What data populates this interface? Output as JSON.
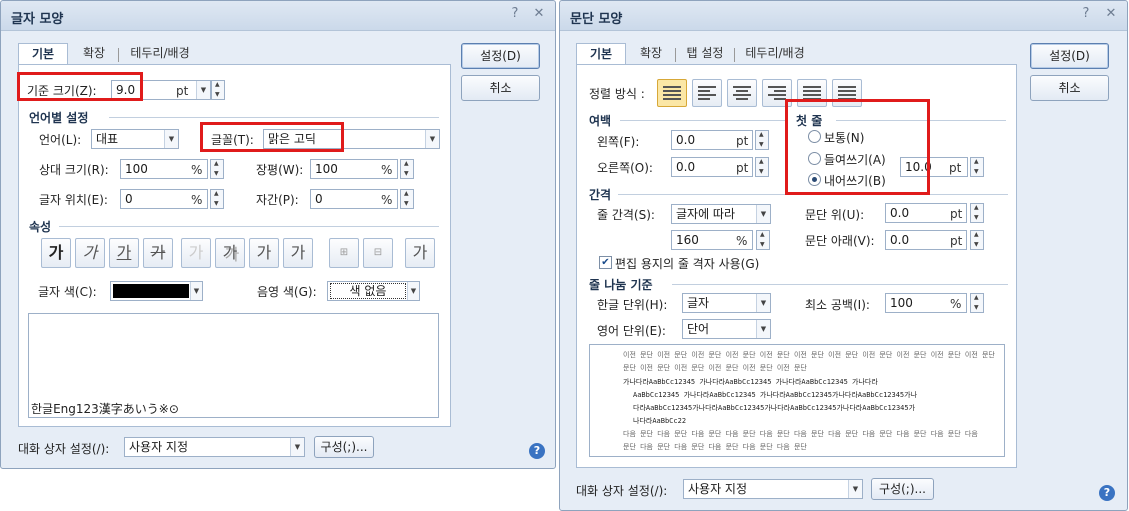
{
  "left": {
    "title": "글자 모양",
    "help_btn": "?",
    "close_btn": "✕",
    "tabs": [
      "기본",
      "확장",
      "테두리/배경"
    ],
    "base_size_label": "기준 크기(Z):",
    "base_size_value": "9.0",
    "base_size_unit": "pt",
    "lang_section": "언어별 설정",
    "lang_label": "언어(L):",
    "lang_value": "대표",
    "font_label": "글꼴(T):",
    "font_value": "맑은 고딕",
    "rel_size_label": "상대 크기(R):",
    "rel_size_value": "100",
    "rel_size_unit": "%",
    "width_label": "장평(W):",
    "width_value": "100",
    "width_unit": "%",
    "pos_label": "글자 위치(E):",
    "pos_value": "0",
    "pos_unit": "%",
    "spacing_label": "자간(P):",
    "spacing_value": "0",
    "spacing_unit": "%",
    "attr_section": "속성",
    "attr_buttons": [
      "가",
      "가",
      "가",
      "가",
      "가",
      "가",
      "가",
      "가",
      "가"
    ],
    "color_label": "글자 색(C):",
    "shade_label": "음영 색(G):",
    "shade_value": "색 없음",
    "preview_text": "한글Eng123漢字あいう※⊙",
    "dialog_setting_label": "대화 상자 설정(/):",
    "dialog_setting_value": "사용자 지정",
    "config_btn": "구성(;)...",
    "ok_btn": "설정(D)",
    "cancel_btn": "취소"
  },
  "right": {
    "title": "문단 모양",
    "help_btn": "?",
    "close_btn": "✕",
    "tabs": [
      "기본",
      "확장",
      "탭 설정",
      "테두리/배경"
    ],
    "align_label": "정렬 방식 :",
    "margin_section": "여백",
    "left_label": "왼쪽(F):",
    "left_value": "0.0",
    "left_unit": "pt",
    "right_label": "오른쪽(O):",
    "right_value": "0.0",
    "right_unit": "pt",
    "first_line_section": "첫 줄",
    "radio_normal": "보통(N)",
    "radio_indent": "들여쓰기(A)",
    "radio_hanging": "내어쓰기(B)",
    "indent_value": "10.0",
    "indent_unit": "pt",
    "spacing_section": "간격",
    "line_spacing_label": "줄 간격(S):",
    "line_spacing_value": "글자에 따라",
    "line_spacing_pct": "160",
    "line_spacing_unit": "%",
    "para_above_label": "문단 위(U):",
    "para_above_value": "0.0",
    "para_above_unit": "pt",
    "para_below_label": "문단 아래(V):",
    "para_below_value": "0.0",
    "para_below_unit": "pt",
    "grid_check_label": "편집 용지의 줄 격자 사용(G)",
    "linebreak_section": "줄 나눔 기준",
    "hangul_unit_label": "한글 단위(H):",
    "hangul_unit_value": "글자",
    "english_unit_label": "영어 단위(E):",
    "english_unit_value": "단어",
    "min_space_label": "최소 공백(I):",
    "min_space_value": "100",
    "min_space_unit": "%",
    "preview_lines": [
      "이전 문단 이전 문단 이전 문단 이전 문단 이전 문단 이전 문단 이전 문단 이전 문단 이전 문단 이전 문단 이전 문단",
      "문단 이전 문단 이전 문단 이전 문단 이전 문단 이전 문단",
      "가나다라AaBbCc12345   가나다라AaBbCc12345   가나다라AaBbCc12345   가나다라",
      "AaBbCc12345 가나다라AaBbCc12345 가나다라AaBbCc12345가나다라AaBbCc12345가나",
      "다라AaBbCc12345가나다라AaBbCc12345가나다라AaBbCc12345가나다라AaBbCc12345가",
      "나다라AaBbCc22",
      "다음 문단 다음 문단 다음 문단 다음 문단 다음 문단 다음 문단 다음 문단 다음 문단 다음 문단 다음 문단 다음",
      "문단 다음 문단 다음 문단 다음 문단 다음 문단 다음 문단"
    ],
    "dialog_setting_label": "대화 상자 설정(/):",
    "dialog_setting_value": "사용자 지정",
    "config_btn": "구성(;)...",
    "ok_btn": "설정(D)",
    "cancel_btn": "취소"
  }
}
